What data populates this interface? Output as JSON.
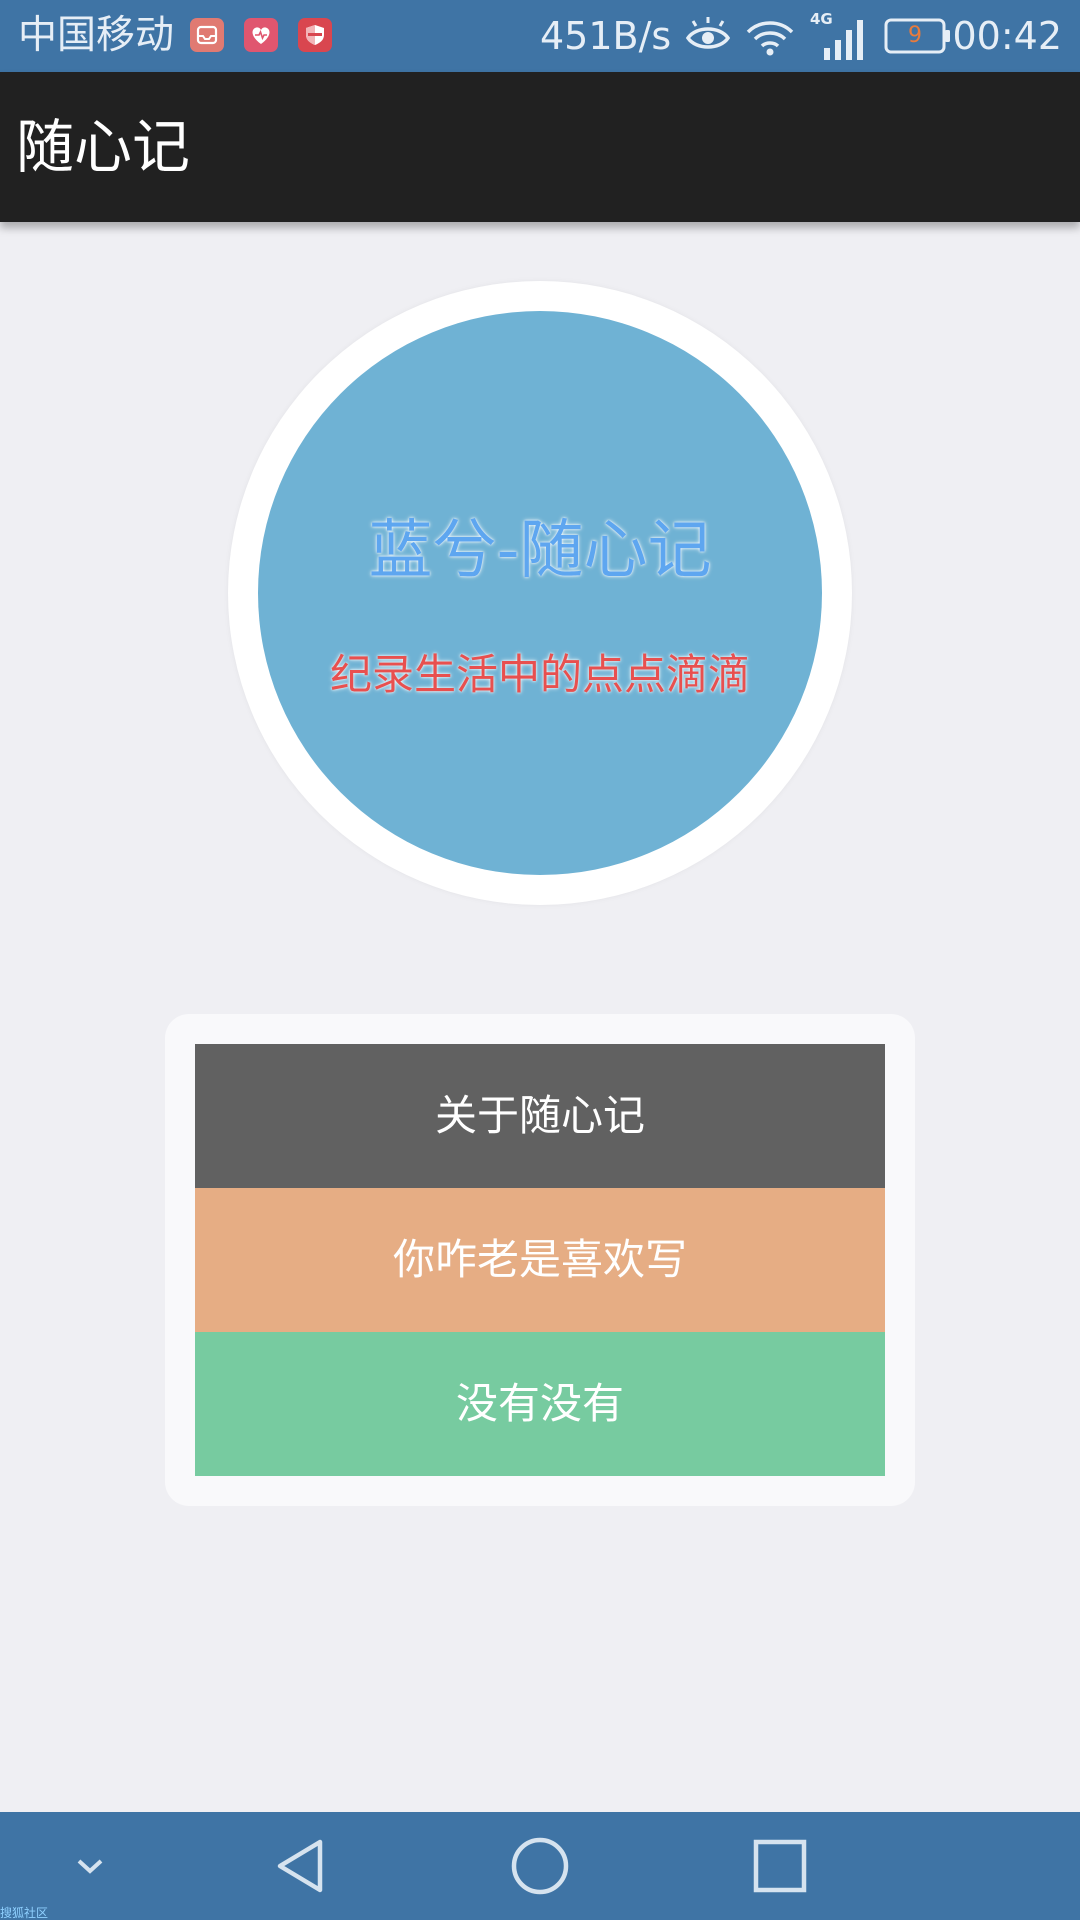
{
  "status_bar": {
    "carrier": "中国移动",
    "net_speed": "451B/s",
    "network_type": "4G",
    "battery_level": "9",
    "time": "00:42",
    "icons": [
      "inbox-notification-icon",
      "health-notification-icon",
      "shield-notification-icon",
      "eye-icon",
      "wifi-icon",
      "signal-icon",
      "battery-icon"
    ],
    "colors": {
      "background": "#3f74a5",
      "notif_icon_bg": "#e06a6a"
    }
  },
  "app_bar": {
    "title": "随心记",
    "colors": {
      "background": "#212121",
      "text": "#ffffff"
    }
  },
  "hero": {
    "title": "蓝兮-随心记",
    "subtitle": "纪录生活中的点点滴滴",
    "colors": {
      "circle": "#6fb2d4",
      "ring": "#ffffff",
      "title": "#5ea6f0",
      "subtitle": "#e8504f"
    }
  },
  "menu": {
    "items": [
      {
        "label": "关于随心记",
        "color": "#616161"
      },
      {
        "label": "你咋老是喜欢写",
        "color": "#e6ad84"
      },
      {
        "label": "没有没有",
        "color": "#77cba0"
      }
    ]
  },
  "nav_bar": {
    "icons": [
      "chevron-down-icon",
      "back-icon",
      "home-icon",
      "recents-icon"
    ],
    "watermark": "搜狐社区",
    "colors": {
      "background": "#3f74a5"
    }
  }
}
